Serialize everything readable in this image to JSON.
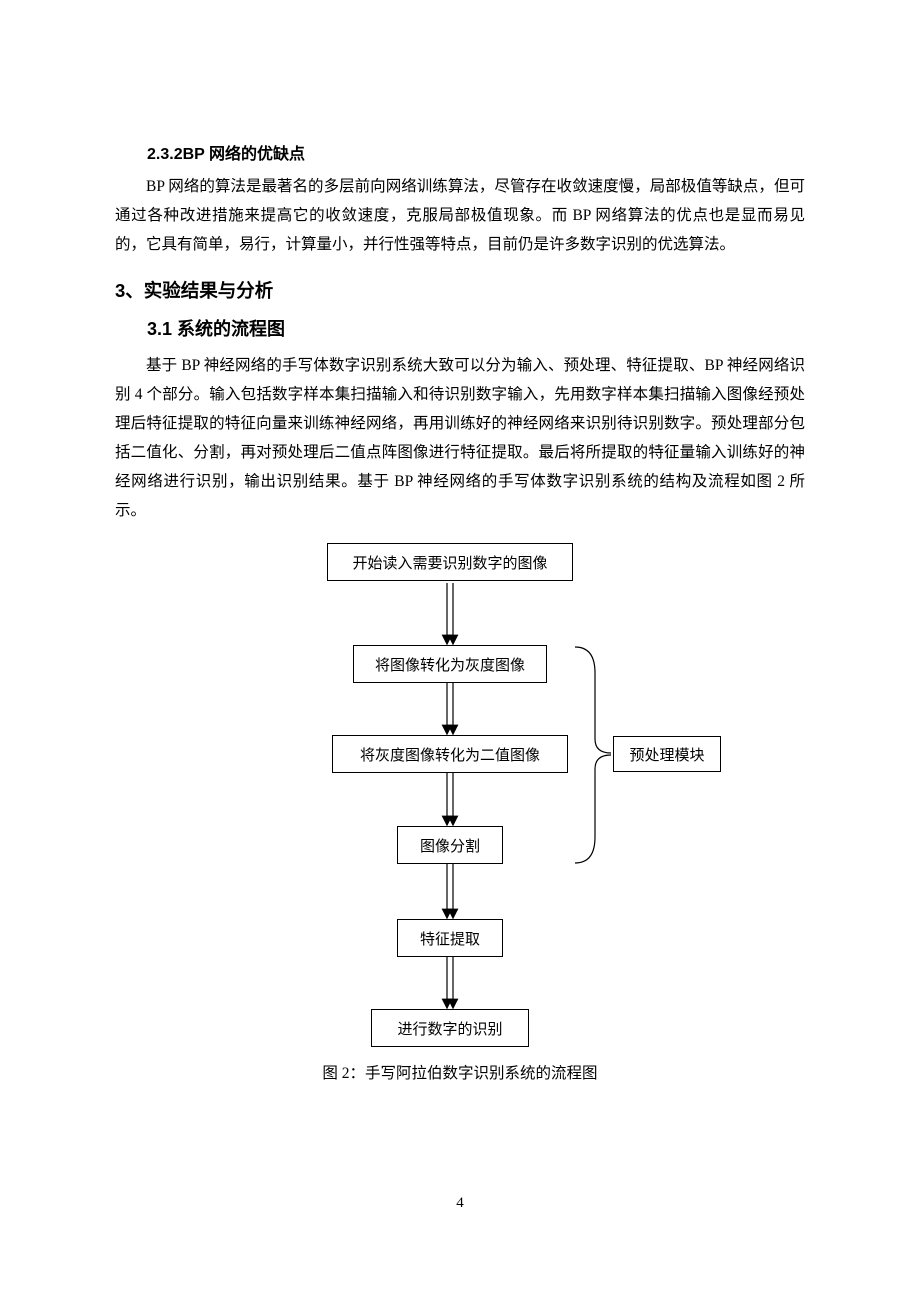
{
  "sec232": {
    "heading": "2.3.2BP 网络的优缺点",
    "para": "BP 网络的算法是最著名的多层前向网络训练算法，尽管存在收敛速度慢，局部极值等缺点，但可通过各种改进措施来提高它的收敛速度，克服局部极值现象。而 BP 网络算法的优点也是显而易见的，它具有简单，易行，计算量小，并行性强等特点，目前仍是许多数字识别的优选算法。"
  },
  "sec3": {
    "heading": "3、实验结果与分析"
  },
  "sec31": {
    "heading": "3.1 系统的流程图",
    "para": "基于 BP 神经网络的手写体数字识别系统大致可以分为输入、预处理、特征提取、BP 神经网络识别 4 个部分。输入包括数字样本集扫描输入和待识别数字输入，先用数字样本集扫描输入图像经预处理后特征提取的特征向量来训练神经网络，再用训练好的神经网络来识别待识别数字。预处理部分包括二值化、分割，再对预处理后二值点阵图像进行特征提取。最后将所提取的特征量输入训练好的神经网络进行识别，输出识别结果。基于 BP 神经网络的手写体数字识别系统的结构及流程如图 2 所示。"
  },
  "flow": {
    "n1": "开始读入需要识别数字的图像",
    "n2": "将图像转化为灰度图像",
    "n3": "将灰度图像转化为二值图像",
    "n4": "图像分割",
    "n5": "特征提取",
    "n6": "进行数字的识别",
    "side": "预处理模块",
    "caption": "图 2：手写阿拉伯数字识别系统的流程图"
  },
  "page_number": "4"
}
